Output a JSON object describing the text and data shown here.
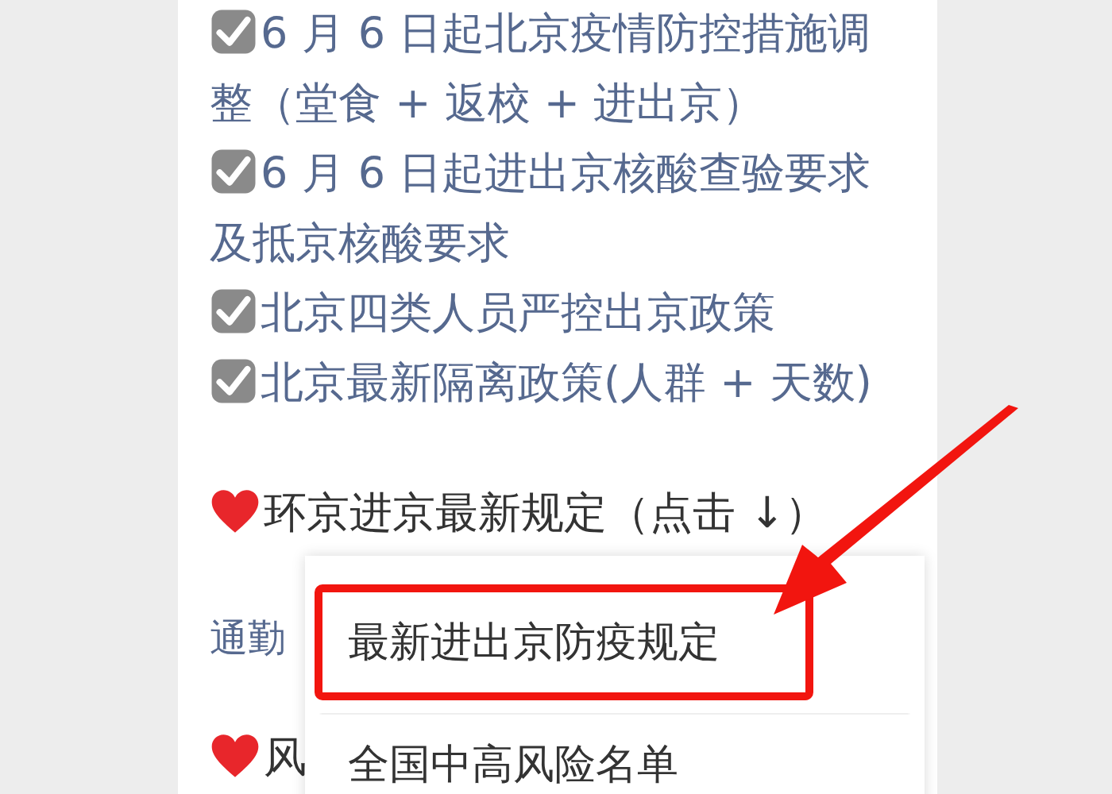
{
  "checklist": [
    {
      "text": "6 月 6 日起北京疫情防控措施调整（堂食 + 返校 + 进出京）",
      "checked": true
    },
    {
      "text": "6 月 6 日起进出京核酸查验要求及抵京核酸要求",
      "checked": true
    },
    {
      "text": "北京四类人员严控出京政策",
      "checked": true
    },
    {
      "text": "北京最新隔离政策(人群 + 天数)",
      "checked": true
    }
  ],
  "section_heading": "环京进京最新规定（点击 ↓）",
  "link": "通勤",
  "next_heading": "风",
  "popup_menu": {
    "items": [
      {
        "label": "最新进出京防疫规定",
        "highlighted": true
      },
      {
        "label": "全国中高风险名单",
        "highlighted": false
      }
    ]
  }
}
